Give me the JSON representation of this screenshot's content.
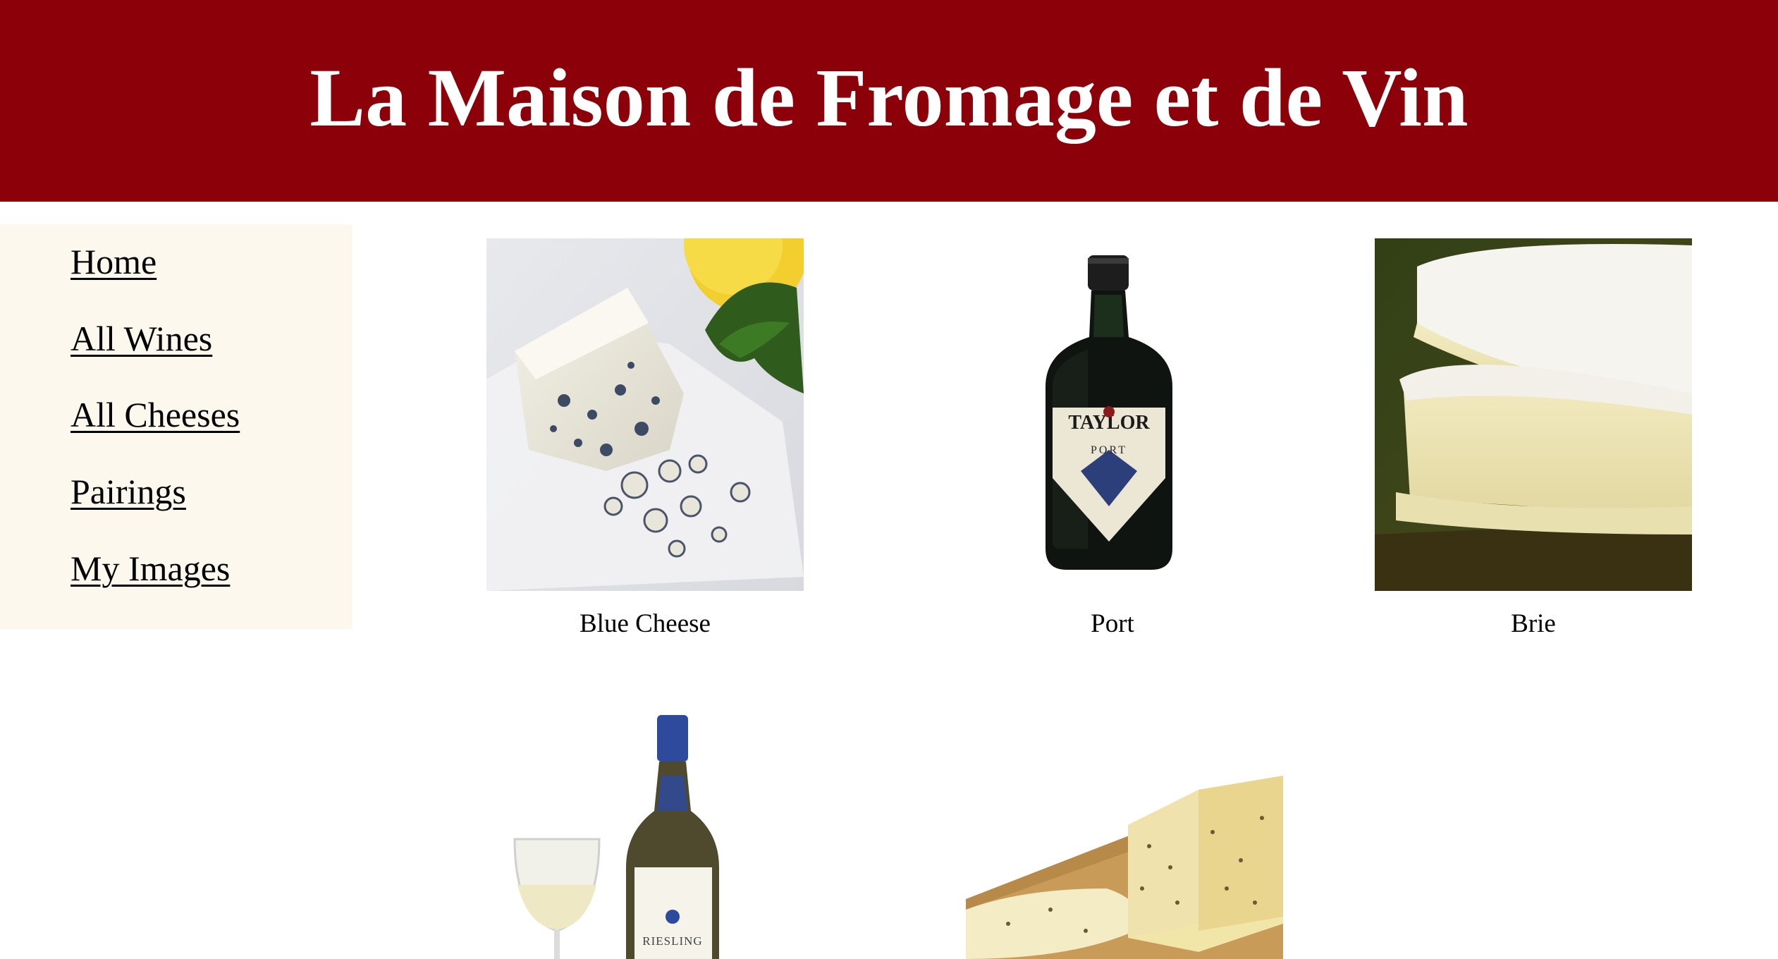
{
  "header": {
    "title": "La Maison de Fromage et de Vin",
    "background_color": "#8b0009",
    "text_color": "#ffffff"
  },
  "sidebar": {
    "background_color": "#fdf8ee",
    "items": [
      {
        "label": "Home"
      },
      {
        "label": "All Wines"
      },
      {
        "label": "All Cheeses"
      },
      {
        "label": "Pairings"
      },
      {
        "label": "My Images"
      }
    ]
  },
  "gallery": {
    "items": [
      {
        "caption": "Blue Cheese",
        "image": "blue-cheese-photo"
      },
      {
        "caption": "Port",
        "image": "port-bottle-photo",
        "label_text": "TAYLOR",
        "label_sub": "PORT"
      },
      {
        "caption": "Brie",
        "image": "brie-photo"
      },
      {
        "caption": "",
        "image": "riesling-bottle-photo",
        "label_text": "RIESLING"
      },
      {
        "caption": "",
        "image": "cheese-block-photo"
      }
    ]
  }
}
